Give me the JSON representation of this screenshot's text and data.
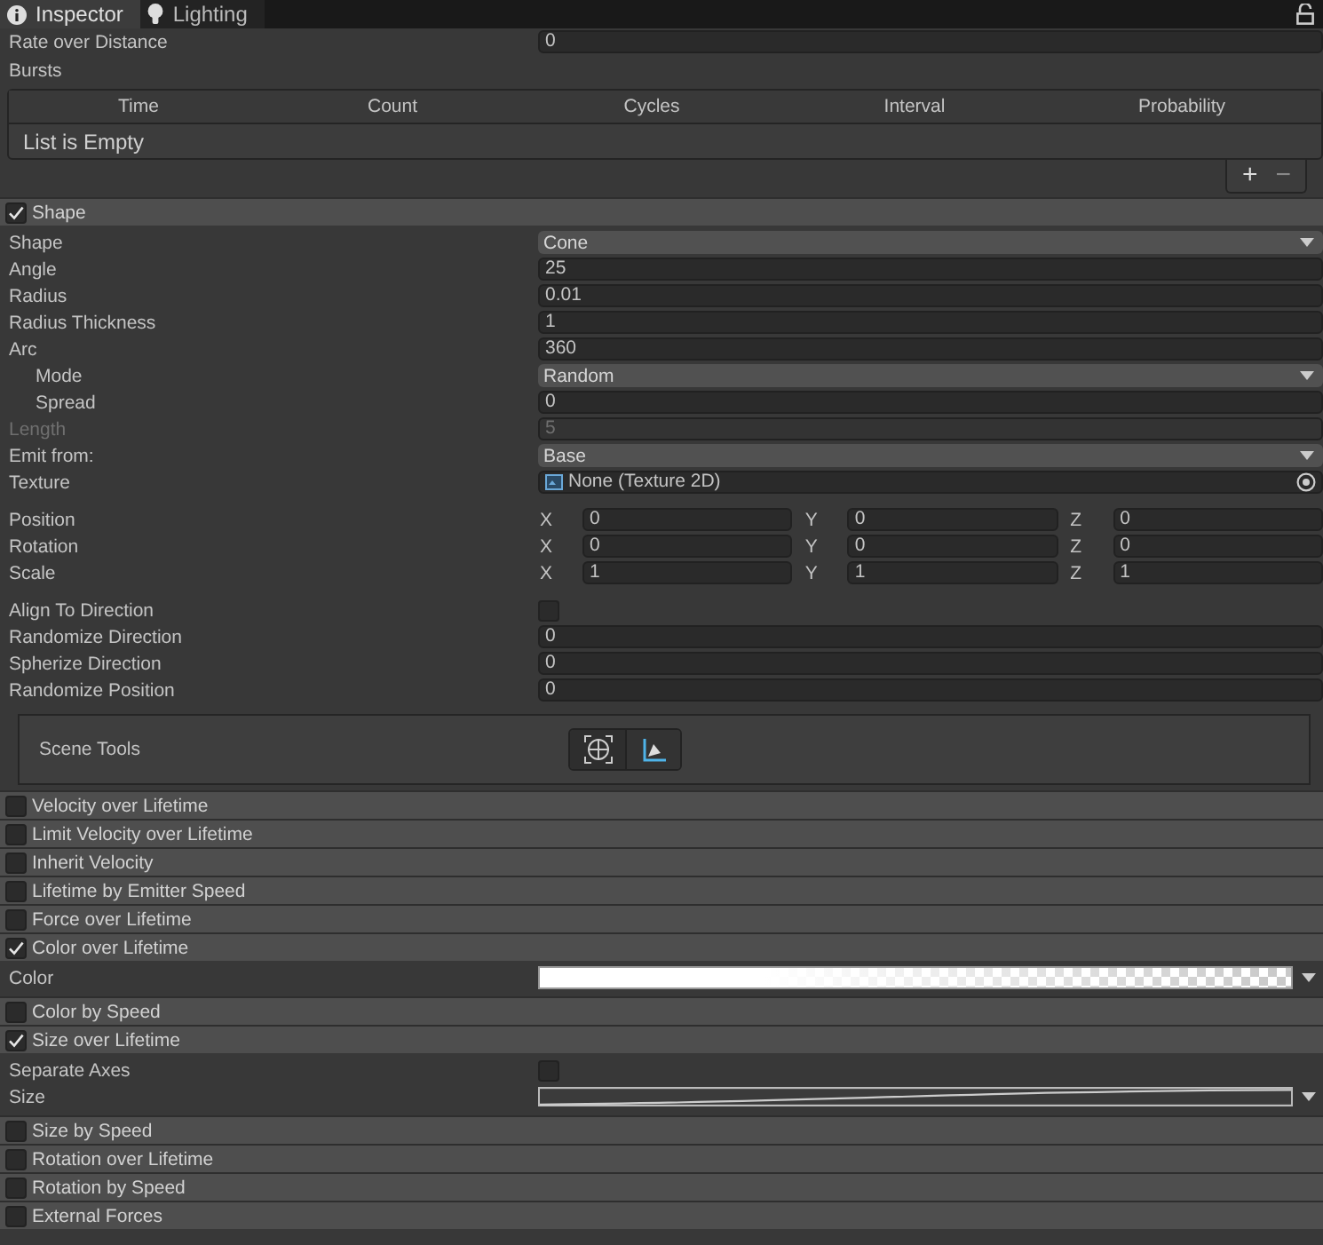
{
  "tabs": [
    {
      "label": "Inspector",
      "kind": "info",
      "selected": true
    },
    {
      "label": "Lighting",
      "kind": "bulb",
      "selected": false
    }
  ],
  "top_field": {
    "label": "Rate over Distance",
    "value": "0"
  },
  "bursts": {
    "label": "Bursts",
    "columns": [
      "Time",
      "Count",
      "Cycles",
      "Interval",
      "Probability"
    ],
    "empty_text": "List is Empty",
    "add": "+",
    "remove": "−"
  },
  "modules": [
    {
      "title": "Shape",
      "checked": true,
      "groups": [
        [
          {
            "kind": "dropdown",
            "label": "Shape",
            "value": "Cone"
          },
          {
            "kind": "number",
            "label": "Angle",
            "value": "25"
          },
          {
            "kind": "number",
            "label": "Radius",
            "value": "0.01"
          },
          {
            "kind": "number",
            "label": "Radius Thickness",
            "value": "1"
          },
          {
            "kind": "number",
            "label": "Arc",
            "value": "360"
          },
          {
            "kind": "dropdown",
            "label": "Mode",
            "value": "Random",
            "indented": true
          },
          {
            "kind": "number",
            "label": "Spread",
            "value": "0",
            "indented": true
          },
          {
            "kind": "number",
            "label": "Length",
            "value": "5",
            "disabled": true
          },
          {
            "kind": "dropdown",
            "label": "Emit from:",
            "value": "Base"
          },
          {
            "kind": "object",
            "label": "Texture",
            "value": "None (Texture 2D)"
          }
        ],
        [
          {
            "kind": "vector",
            "label": "Position",
            "components": [
              {
                "axis": "X",
                "value": "0"
              },
              {
                "axis": "Y",
                "value": "0"
              },
              {
                "axis": "Z",
                "value": "0"
              }
            ]
          },
          {
            "kind": "vector",
            "label": "Rotation",
            "components": [
              {
                "axis": "X",
                "value": "0"
              },
              {
                "axis": "Y",
                "value": "0"
              },
              {
                "axis": "Z",
                "value": "0"
              }
            ]
          },
          {
            "kind": "vector",
            "label": "Scale",
            "components": [
              {
                "axis": "X",
                "value": "1"
              },
              {
                "axis": "Y",
                "value": "1"
              },
              {
                "axis": "Z",
                "value": "1"
              }
            ]
          }
        ],
        [
          {
            "kind": "checkbox",
            "label": "Align To Direction",
            "checked": false
          },
          {
            "kind": "number",
            "label": "Randomize Direction",
            "value": "0"
          },
          {
            "kind": "number",
            "label": "Spherize Direction",
            "value": "0"
          },
          {
            "kind": "number",
            "label": "Randomize Position",
            "value": "0"
          }
        ],
        [
          {
            "kind": "tools",
            "label": "Scene Tools"
          }
        ]
      ]
    },
    {
      "title": "Velocity over Lifetime",
      "checked": false
    },
    {
      "title": "Limit Velocity over Lifetime",
      "checked": false
    },
    {
      "title": "Inherit Velocity",
      "checked": false
    },
    {
      "title": "Lifetime by Emitter Speed",
      "checked": false
    },
    {
      "title": "Force over Lifetime",
      "checked": false
    },
    {
      "title": "Color over Lifetime",
      "checked": true,
      "groups": [
        [
          {
            "kind": "gradient",
            "label": "Color"
          }
        ]
      ]
    },
    {
      "title": "Color by Speed",
      "checked": false
    },
    {
      "title": "Size over Lifetime",
      "checked": true,
      "groups": [
        [
          {
            "kind": "checkbox",
            "label": "Separate Axes",
            "checked": false
          },
          {
            "kind": "curve",
            "label": "Size"
          }
        ]
      ]
    },
    {
      "title": "Size by Speed",
      "checked": false
    },
    {
      "title": "Rotation over Lifetime",
      "checked": false
    },
    {
      "title": "Rotation by Speed",
      "checked": false
    },
    {
      "title": "External Forces",
      "checked": false
    }
  ]
}
